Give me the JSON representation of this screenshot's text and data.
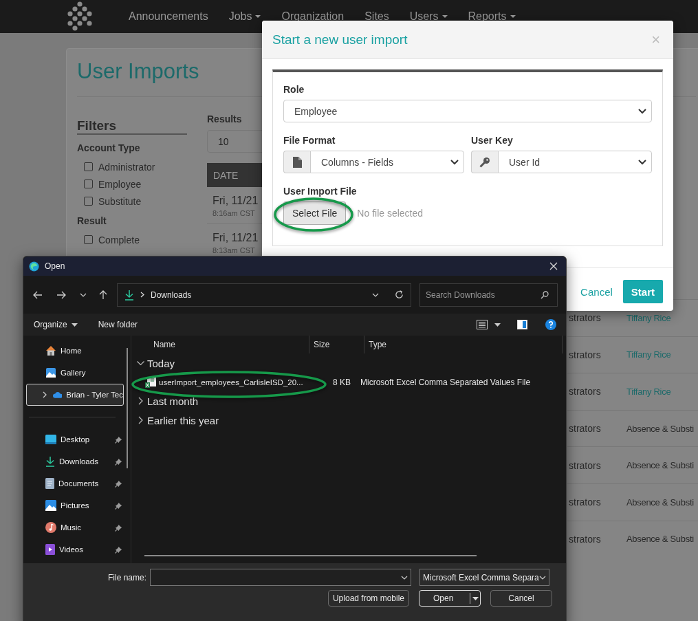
{
  "nav": {
    "items": [
      {
        "label": "Announcements",
        "dropdown": false
      },
      {
        "label": "Jobs",
        "dropdown": true
      },
      {
        "label": "Organization",
        "dropdown": false
      },
      {
        "label": "Sites",
        "dropdown": false
      },
      {
        "label": "Users",
        "dropdown": true
      },
      {
        "label": "Reports",
        "dropdown": true
      }
    ]
  },
  "page": {
    "title": "User Imports",
    "filters": {
      "title": "Filters",
      "groups": [
        {
          "title": "Account Type",
          "options": [
            {
              "label": "Administrator",
              "checked": false
            },
            {
              "label": "Employee",
              "checked": false
            },
            {
              "label": "Substitute",
              "checked": false
            }
          ]
        },
        {
          "title": "Result",
          "options": [
            {
              "label": "Complete",
              "checked": false
            }
          ]
        }
      ]
    },
    "results": {
      "label": "Results",
      "value": "10"
    },
    "table": {
      "columns": [
        {
          "label": "DATE"
        }
      ],
      "date_rows": [
        {
          "date": "Fri, 11/21",
          "time": "8:16am CST"
        },
        {
          "date": "Fri, 11/21",
          "time": "8:13am CST"
        }
      ],
      "rows": [
        {
          "column_2": "strators",
          "column_3": "Tiffany Rice",
          "kind": "link"
        },
        {
          "column_2": "strators",
          "column_3": "Tiffany Rice",
          "kind": "link"
        },
        {
          "column_2": "strators",
          "column_3": "Tiffany Rice",
          "kind": "link"
        },
        {
          "column_2": "strators",
          "column_3": "Absence & Substi",
          "kind": "text"
        },
        {
          "column_2": "strators",
          "column_3": "Absence & Substi",
          "kind": "text"
        },
        {
          "column_2": "strators",
          "column_3": "Absence & Substi",
          "kind": "text"
        },
        {
          "column_2": "strators",
          "column_3": "Absence & Substi",
          "kind": "text"
        }
      ]
    }
  },
  "modal": {
    "title": "Start a new user import",
    "close": "×",
    "role": {
      "label": "Role",
      "value": "Employee"
    },
    "file_format": {
      "label": "File Format",
      "value": "Columns - Fields"
    },
    "user_key": {
      "label": "User Key",
      "value": "User Id"
    },
    "file": {
      "label": "User Import File",
      "button": "Select File",
      "status": "No file selected"
    },
    "buttons": {
      "cancel": "Cancel",
      "start": "Start"
    }
  },
  "dialog": {
    "title": "Open",
    "path": "Downloads",
    "search": {
      "placeholder": "Search Downloads"
    },
    "commands": [
      {
        "label": "Organize",
        "dropdown": true
      },
      {
        "label": "New folder",
        "dropdown": false
      }
    ],
    "nav_pane": {
      "items": [
        {
          "label": "Home",
          "selected": false,
          "kind": "place"
        },
        {
          "label": "Gallery",
          "selected": false,
          "kind": "place"
        },
        {
          "label": "Brian - Tyler Tec",
          "selected": true,
          "kind": "cloud",
          "expanded": false
        }
      ],
      "pinned": [
        {
          "label": "Desktop",
          "selected": false,
          "pinned": true
        },
        {
          "label": "Downloads",
          "selected": false,
          "pinned": true
        },
        {
          "label": "Documents",
          "selected": false,
          "pinned": true
        },
        {
          "label": "Pictures",
          "selected": false,
          "pinned": true
        },
        {
          "label": "Music",
          "selected": false,
          "pinned": true
        },
        {
          "label": "Videos",
          "selected": false,
          "pinned": true
        }
      ]
    },
    "columns": [
      {
        "label": "Name"
      },
      {
        "label": "Size"
      },
      {
        "label": "Type"
      }
    ],
    "groups": [
      {
        "label": "Today",
        "expanded": true,
        "children": [
          {
            "name": "userImport_employees_CarlisleISD_20...",
            "size": "8 KB",
            "type": "Microsoft Excel Comma Separated Values File"
          }
        ]
      },
      {
        "label": "Last month",
        "expanded": false
      },
      {
        "label": "Earlier this year",
        "expanded": false
      }
    ],
    "file_name": {
      "label": "File name:"
    },
    "file_type": "Microsoft Excel Comma Separa",
    "buttons": [
      {
        "label": "Upload from mobile",
        "kind": "plain"
      },
      {
        "label": "Open",
        "kind": "split"
      },
      {
        "label": "Cancel",
        "kind": "plain"
      }
    ]
  }
}
